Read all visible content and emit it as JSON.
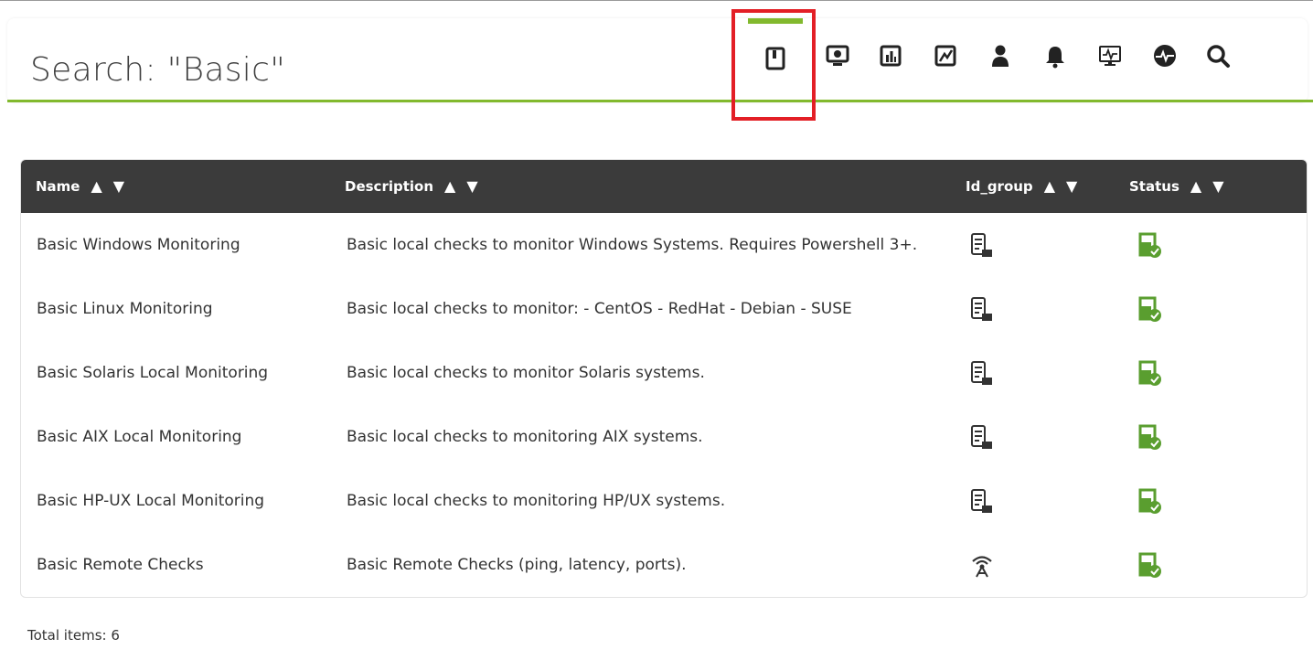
{
  "page": {
    "title": "Search: \"Basic\""
  },
  "toolbar": {
    "icons": [
      "policy-icon",
      "agent-icon",
      "report-icon",
      "graph-icon",
      "user-icon",
      "alert-icon",
      "monitor-icon",
      "module-icon",
      "search-icon"
    ],
    "accent_color": "#82b92e",
    "highlight_color": "#e31f26"
  },
  "table": {
    "headers": {
      "name": "Name",
      "description": "Description",
      "id_group": "Id_group",
      "status": "Status"
    },
    "sort_up": "▲",
    "sort_down": "▼",
    "rows": [
      {
        "name": "Basic Windows Monitoring",
        "description": "Basic local checks to monitor Windows Systems. Requires Powershell 3+.",
        "group_icon": "server-icon",
        "status_icon": "status-ok-icon"
      },
      {
        "name": "Basic Linux Monitoring",
        "description": "Basic local checks to monitor: - CentOS - RedHat - Debian - SUSE",
        "group_icon": "server-icon",
        "status_icon": "status-ok-icon"
      },
      {
        "name": "Basic Solaris Local Monitoring",
        "description": "Basic local checks to monitor Solaris systems.",
        "group_icon": "server-icon",
        "status_icon": "status-ok-icon"
      },
      {
        "name": "Basic AIX Local Monitoring",
        "description": "Basic local checks to monitoring AIX systems.",
        "group_icon": "server-icon",
        "status_icon": "status-ok-icon"
      },
      {
        "name": "Basic HP-UX Local Monitoring",
        "description": "Basic local checks to monitoring HP/UX systems.",
        "group_icon": "server-icon",
        "status_icon": "status-ok-icon"
      },
      {
        "name": "Basic Remote Checks",
        "description": "Basic Remote Checks (ping, latency, ports).",
        "group_icon": "antenna-icon",
        "status_icon": "status-ok-icon"
      }
    ]
  },
  "footer": {
    "total_label": "Total items: 6"
  }
}
